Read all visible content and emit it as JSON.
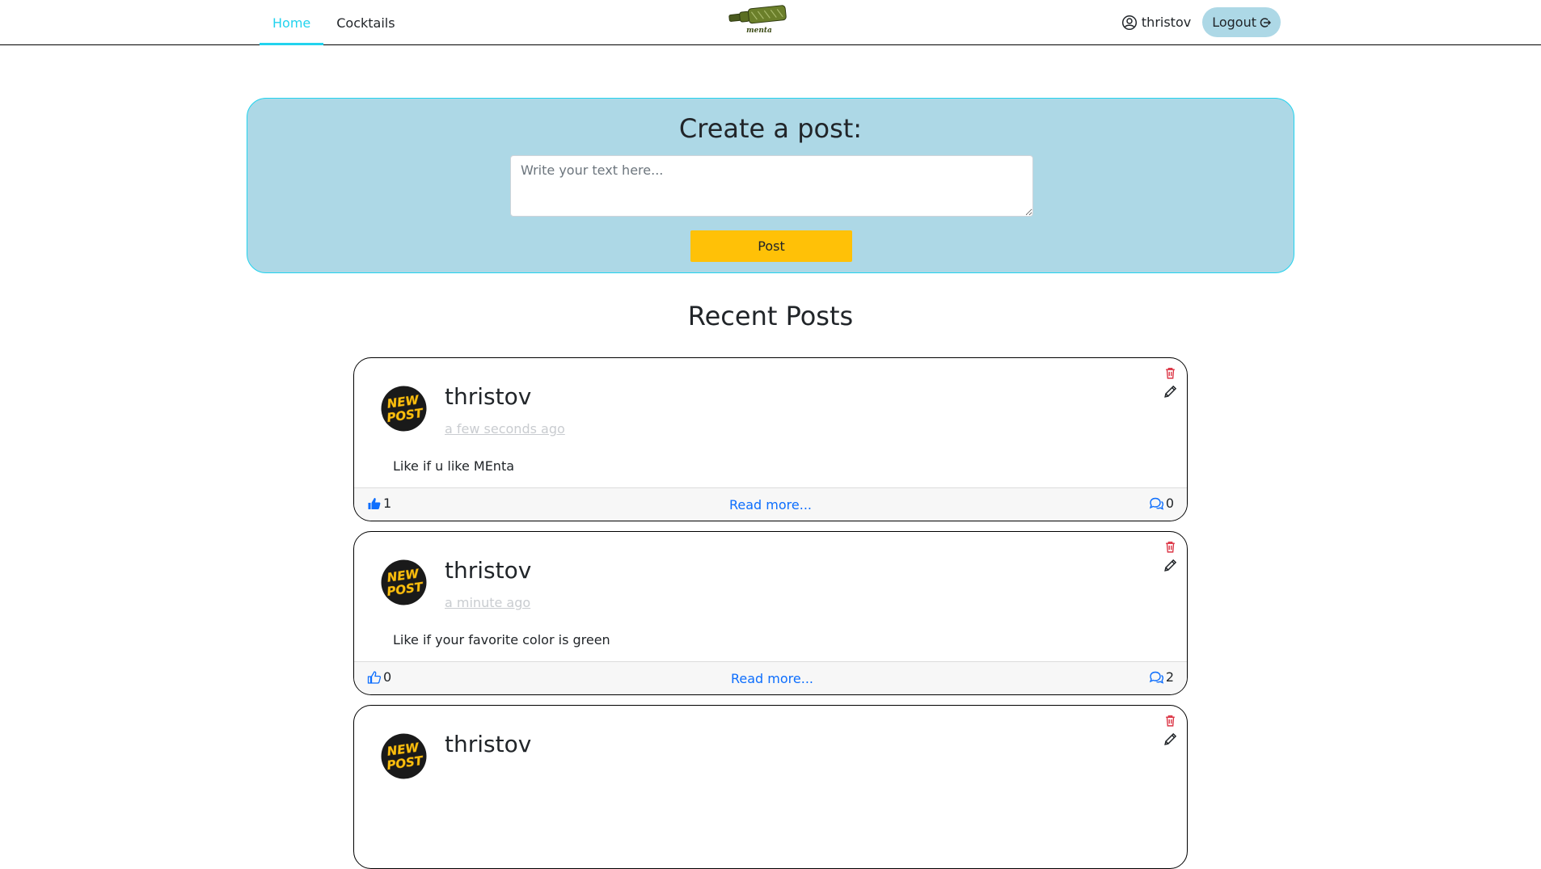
{
  "nav": {
    "links": [
      {
        "label": "Home",
        "active": true
      },
      {
        "label": "Cocktails",
        "active": false
      }
    ],
    "brand_text": "menta",
    "username": "thristov",
    "logout_label": "Logout"
  },
  "create_post": {
    "title": "Create a post:",
    "placeholder": "Write your text here...",
    "button_label": "Post"
  },
  "recent_posts": {
    "title": "Recent Posts",
    "posts": [
      {
        "author": "thristov",
        "time": "a few seconds ago",
        "body": "Like if u like MEnta",
        "likes": "1",
        "liked": true,
        "comments": "0",
        "read_more": "Read more..."
      },
      {
        "author": "thristov",
        "time": "a minute ago",
        "body": "Like if your favorite color is green",
        "likes": "0",
        "liked": false,
        "comments": "2",
        "read_more": "Read more..."
      },
      {
        "author": "thristov",
        "time": "",
        "body": "",
        "likes": "",
        "liked": false,
        "comments": "",
        "read_more": ""
      }
    ]
  },
  "avatar_text": [
    "NEW",
    "POST"
  ],
  "colors": {
    "accent": "#22d3ee",
    "panel": "#add8e6",
    "post_button": "#ffc107",
    "link": "#0d6efd",
    "delete": "#dc3545"
  }
}
